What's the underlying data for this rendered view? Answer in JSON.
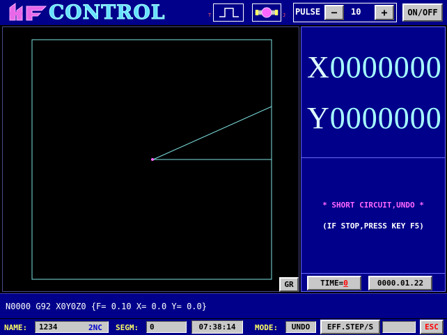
{
  "header": {
    "logo_mark": "HF",
    "logo_text": "CONTROL",
    "pulse_label": "PULSE",
    "pulse_minus": "−",
    "pulse_value": "10",
    "pulse_plus": "+",
    "onoff_label": "ON/OFF",
    "signal_left_tiny": "T",
    "signal_right_tiny": "J"
  },
  "coords": {
    "x_axis": "X",
    "x_value": "0000000",
    "y_axis": "Y",
    "y_value": "0000000"
  },
  "messages": {
    "short_circuit": "* SHORT CIRCUIT,UNDO *",
    "hint": "(IF STOP,PRESS KEY F5)"
  },
  "graph": {
    "gr_button": "GR"
  },
  "timebar": {
    "time_label": "TIME=",
    "time_value": "0",
    "date": "0000.01.22"
  },
  "command_line": "N0000 G92 X0Y0Z0 {F= 0.10 X= 0.0 Y= 0.0}",
  "status": {
    "name_label": "NAME:",
    "name_value": "1234",
    "ext": "2NC",
    "segm_label": "SEGM:",
    "segm_value": "0",
    "clock": "07:38:14",
    "mode_label": "MODE:",
    "mode_value": "UNDO",
    "eff_step": "EFF.STEP/S",
    "esc": "ESC"
  },
  "colors": {
    "panel_blue": "#00008a",
    "path_cyan": "#7fe3e3",
    "message_magenta": "#ff66ff",
    "label_yellow": "#ffff66",
    "esc_red": "#ff0000"
  }
}
